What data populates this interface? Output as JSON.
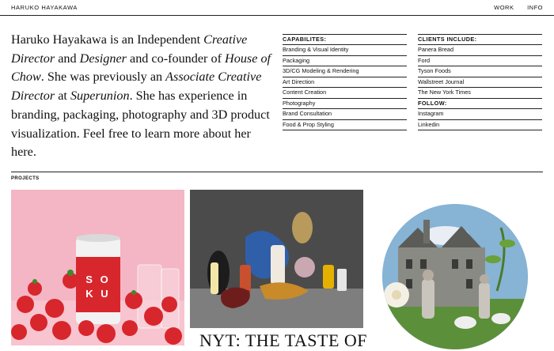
{
  "header": {
    "brand": "HARUKO HAYAKAWA",
    "nav": [
      "WORK",
      "INFO"
    ]
  },
  "intro": {
    "p1": "Haruko Hayakawa is an Independent ",
    "e1": "Creative Director",
    "p2": " and ",
    "e2": "Designer",
    "p3": " and co-founder of ",
    "e3": "House of Chow",
    "p4": ". She was previously an ",
    "e4": "Associate Creative Director",
    "p5": " at ",
    "e5": "Superunion",
    "p6": ". She has experience in branding, packaging, photography and 3D product visualization. Feel free to learn more about her here."
  },
  "capabilities": {
    "title": "CAPABILITES:",
    "items": [
      "Branding & Visual Identity",
      "Packaging",
      "3D/CG Modeling & Rendering",
      "Art Direction",
      "Content Creation",
      "Photography",
      "Brand Consultation",
      "Food & Prop Styling"
    ]
  },
  "clients": {
    "title": "CLIENTS INCLUDE:",
    "items": [
      "Panera Bread",
      "Ford",
      "Tyson Foods",
      "Wallstreet Journal",
      "The New York Times"
    ],
    "follow_title": "FOLLOW:",
    "follow": [
      "Instagram",
      "Linkedin"
    ]
  },
  "projects": {
    "label": "PROJECTS",
    "can_text": "S O K U",
    "caption2": "NYT: THE TASTE OF"
  },
  "colors": {
    "pink": "#f4b5c4",
    "can_red": "#d8262d",
    "dark_bg": "#4a4a4a"
  }
}
